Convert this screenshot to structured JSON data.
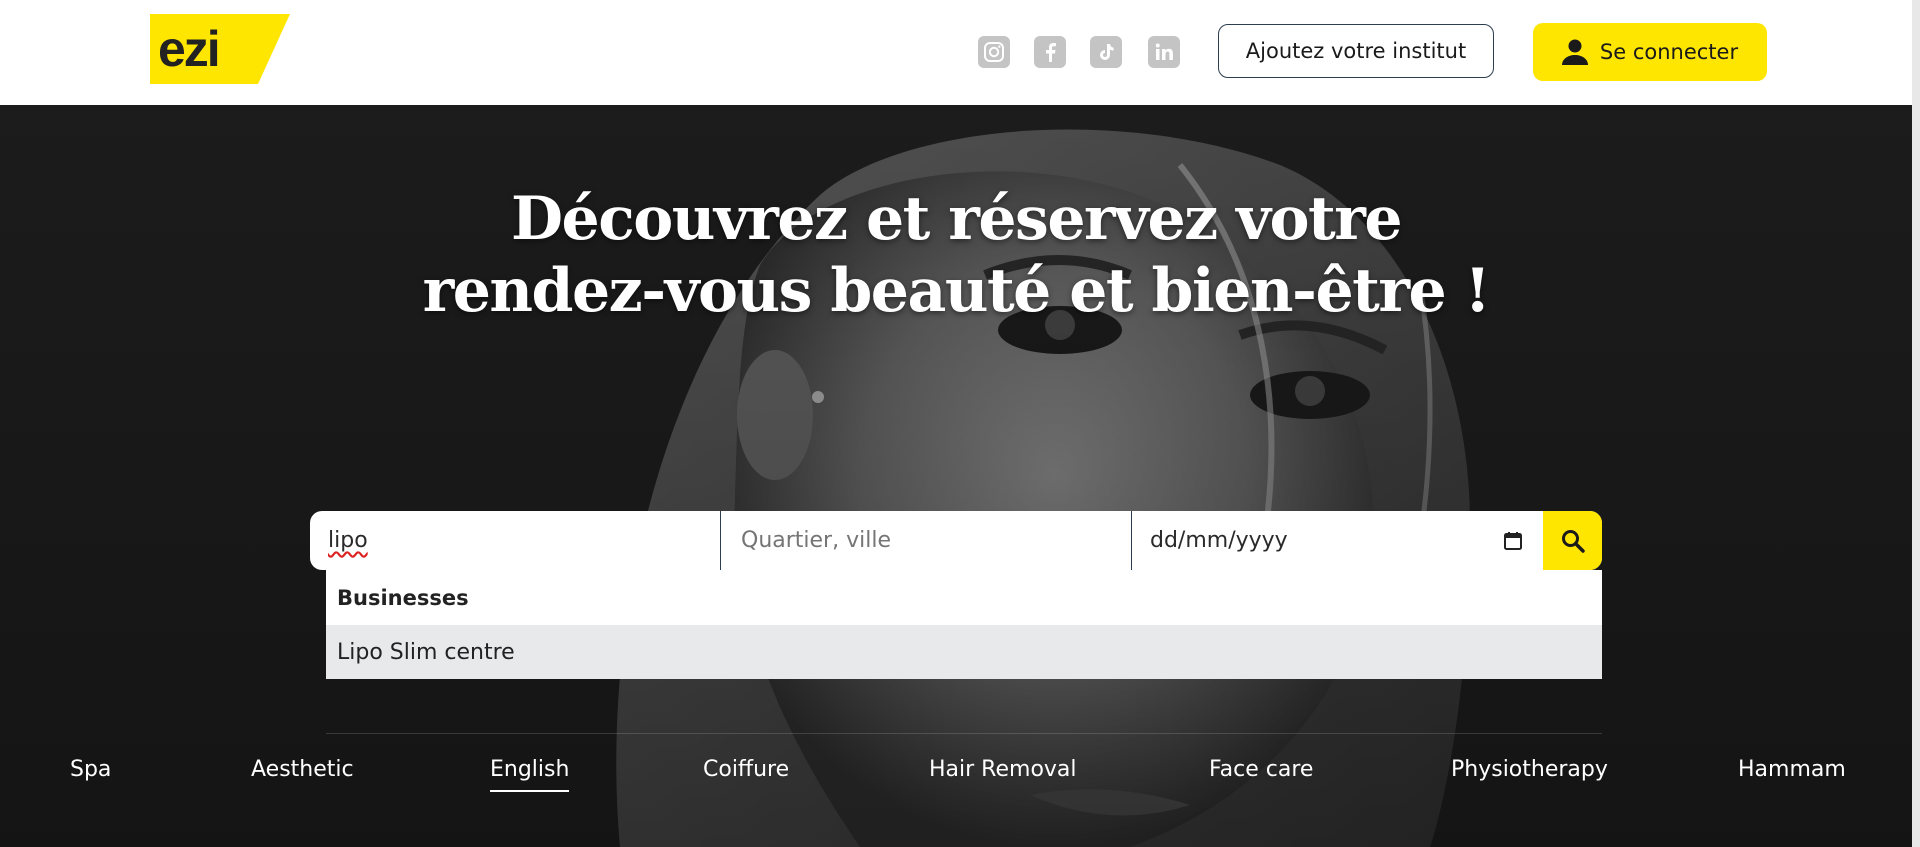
{
  "header": {
    "logo_text": "ezi",
    "social": [
      {
        "icon": "instagram-icon"
      },
      {
        "icon": "facebook-icon"
      },
      {
        "icon": "tiktok-icon"
      },
      {
        "icon": "linkedin-icon"
      }
    ],
    "add_institute_label": "Ajoutez votre institut",
    "login_label": "Se connecter"
  },
  "hero": {
    "title_line1": "Découvrez et réservez votre",
    "title_line2": "rendez-vous beauté et bien-être !"
  },
  "search": {
    "what_value": "lipo",
    "where_placeholder": "Quartier, ville",
    "date_placeholder": "dd/mm/yyyy"
  },
  "dropdown": {
    "section_title": "Businesses",
    "items": [
      "Lipo Slim centre"
    ]
  },
  "categories": [
    {
      "label": "Spa"
    },
    {
      "label": "Aesthetic"
    },
    {
      "label": "English",
      "active": true
    },
    {
      "label": "Coiffure"
    },
    {
      "label": "Hair Removal"
    },
    {
      "label": "Face care"
    },
    {
      "label": "Physiotherapy"
    },
    {
      "label": "Hammam"
    }
  ],
  "colors": {
    "brand_yellow": "#ffe600",
    "text_dark": "#1a1a1a",
    "border_navy": "#2c3e50"
  }
}
